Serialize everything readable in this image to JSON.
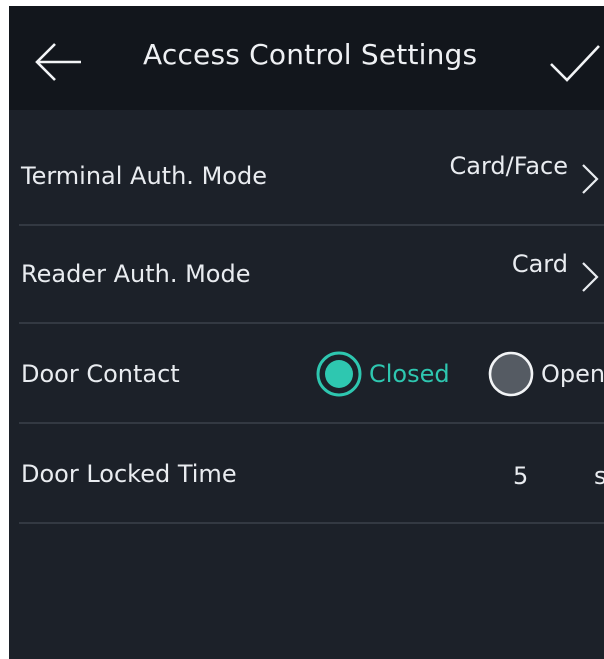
{
  "header": {
    "title": "Access Control Settings",
    "back_icon": "arrow-left-icon",
    "confirm_icon": "checkmark-icon"
  },
  "rows": [
    {
      "label": "Terminal Auth. Mode",
      "value": "Card/Face",
      "icon": "chevron-right-icon"
    },
    {
      "label": "Reader Auth. Mode",
      "value": "Card",
      "icon": "chevron-right-icon"
    }
  ],
  "door_contact": {
    "label": "Door Contact",
    "options": [
      {
        "label": "Closed",
        "selected": true
      },
      {
        "label": "Open",
        "selected": false
      }
    ],
    "accent_color": "#2ec7b0"
  },
  "door_locked_time": {
    "label": "Door Locked Time",
    "value": "5",
    "unit": "s"
  }
}
